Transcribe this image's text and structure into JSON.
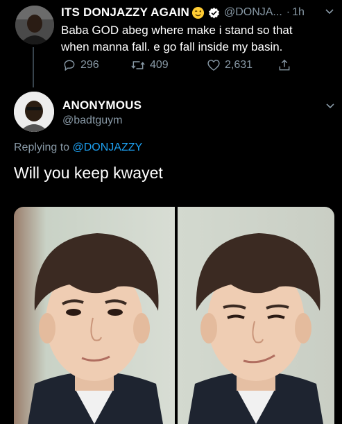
{
  "parent_tweet": {
    "display_name": "ITS DONJAZZY AGAIN",
    "handle": "@DONJA...",
    "separator": "·",
    "time": "1h",
    "text_line1": "Baba GOD abeg where make i stand so that",
    "text_line2": "when manna fall. e go fall inside my basin.",
    "replies": "296",
    "retweets": "409",
    "likes": "2,631"
  },
  "reply_tweet": {
    "display_name": "ANONYMOUS",
    "handle": "@badtguym",
    "replying_prefix": "Replying to ",
    "replying_handle": "@DONJAZZY",
    "text": "Will you keep kwayet"
  },
  "colors": {
    "background": "#000000",
    "muted": "#8899a6",
    "link": "#1da1f2"
  },
  "icons": [
    "emoji-wink-icon",
    "verified-badge-icon",
    "reply-icon",
    "retweet-icon",
    "like-icon",
    "share-icon",
    "chevron-down-icon"
  ]
}
